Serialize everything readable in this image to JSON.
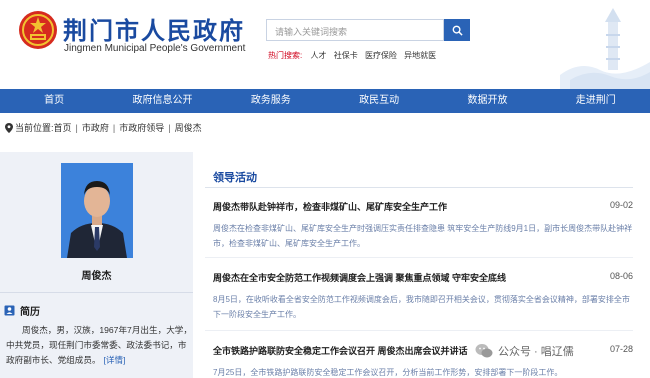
{
  "header": {
    "title": "荆门市人民政府",
    "subtitle": "Jingmen Municipal People's Government",
    "search_placeholder": "请输入关键词搜索",
    "hot_label": "热门搜索:",
    "hot_items": [
      "人才",
      "社保卡",
      "医疗保险",
      "异地就医"
    ]
  },
  "nav": [
    "首页",
    "政府信息公开",
    "政务服务",
    "政民互动",
    "数据开放",
    "走进荆门"
  ],
  "breadcrumb": {
    "prefix": "当前位置:",
    "items": [
      "首页",
      "市政府",
      "市政府领导",
      "周俊杰"
    ]
  },
  "profile": {
    "name": "周俊杰",
    "resume_heading": "简历",
    "resume_text": "周俊杰，男，汉族，1967年7月出生，大学，中共党员，现任荆门市委常委、政法委书记，市政府副市长、党组成员。",
    "detail_link": "[详情]"
  },
  "activities": {
    "heading": "领导活动",
    "items": [
      {
        "title": "周俊杰带队赴钟祥市，检查非煤矿山、尾矿库安全生产工作",
        "date": "09-02",
        "summary": "周俊杰在检查非煤矿山、尾矿库安全生产时强调压实责任排查隐患 筑牢安全生产防线9月1日，副市长周俊杰带队赴钟祥市，检查非煤矿山、尾矿库安全生产工作。"
      },
      {
        "title": "周俊杰在全市安全防范工作视频调度会上强调 聚焦重点领域 守牢安全底线",
        "date": "08-06",
        "summary": "8月5日，在收听收看全省安全防范工作视频调度会后，我市随即召开相关会议，贯彻落实全省会议精神，部署安排全市下一阶段安全生产工作。"
      },
      {
        "title": "全市铁路护路联防安全稳定工作会议召开 周俊杰出席会议并讲话",
        "date": "07-28",
        "summary": "7月25日，全市铁路护路联防安全稳定工作会议召开，分析当前工作形势，安排部署下一阶段工作。"
      }
    ]
  },
  "watermark": "公众号 · 唱辽儒",
  "colors": {
    "brand_blue": "#2a63b6",
    "title_blue": "#1a4aa0",
    "hot_red": "#d0021b",
    "panel_bg": "#eef1f7"
  }
}
